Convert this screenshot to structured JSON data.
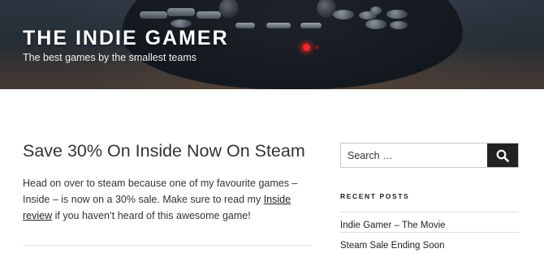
{
  "header": {
    "site_title": "THE INDIE GAMER",
    "tagline": "The best games by the smallest teams",
    "background_image": "game-controller-photo"
  },
  "post": {
    "title": "Save 30% On Inside Now On Steam",
    "body_before_link": "Head on over to steam because one of my favourite games – Inside – is now on a 30% sale. Make sure to read my ",
    "link_text": "Inside review",
    "body_after_link": " if you haven’t heard of this awesome game!"
  },
  "sidebar": {
    "search": {
      "placeholder": "Search …",
      "button_icon": "search-icon"
    },
    "recent_posts": {
      "title": "RECENT POSTS",
      "items": [
        {
          "label": "Indie Gamer – The Movie"
        },
        {
          "label": "Steam Sale Ending Soon"
        }
      ]
    }
  },
  "colors": {
    "search_button": "#222222",
    "led": "#ff2a2a"
  }
}
